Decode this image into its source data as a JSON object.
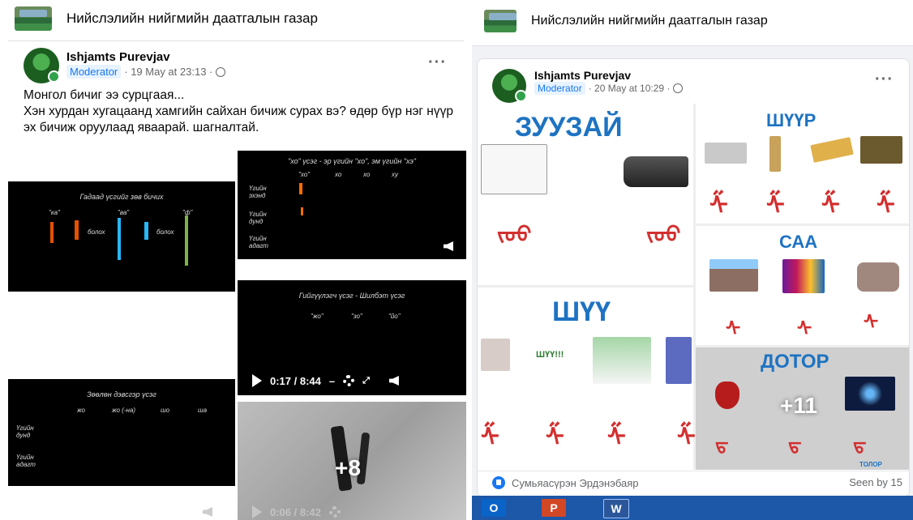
{
  "group": {
    "title": "Нийслэлийн нийгмийн даатгалын газар"
  },
  "left_post": {
    "author": "Ishjamts Purevjav",
    "role": "Moderator",
    "time": "· 19 May at 23:13 ·",
    "text": "Монгол бичиг ээ  сурцгаая...\nХэн хурдан хугацаанд хамгийн сайхан бичиж сурах вэ?  өдөр бүр нэг нүүр  эх бичиж оруулаад яваарай.  шагналтай.",
    "videos": [
      {
        "title": "Гадаад үсгийг зөв бичих",
        "labels": [
          "\"ка\"",
          "\"ва\"",
          "\"ф\"",
          "болох",
          "болох"
        ]
      },
      {
        "title": "\"хо\" үсэг - эр үгийн \"хо\", эм үгийн \"хэ\"",
        "headers": [
          "\"хо\"",
          "хо",
          "хо",
          "ху"
        ],
        "rows": [
          "Үгийн эхэнд",
          "Үгийн дунд",
          "Үгийн адагт"
        ]
      },
      {
        "title": "Гийгүүлэгч үсэг - Шилбэт үсэг",
        "headers": [
          "\"жо\"",
          "\"зо\"",
          "\"йо\""
        ],
        "time": "0:17 / 8:44"
      },
      {
        "title": "Зөөлөн дэвсгэр үсэг",
        "headers": [
          "жо",
          "жо (-на)",
          "шо",
          "ша"
        ],
        "rows": [
          "Үгийн дунд",
          "Үгийн адагт"
        ]
      },
      {
        "count": "+8",
        "time": "0:06 / 8:42"
      }
    ]
  },
  "right_post": {
    "author": "Ishjamts Purevjav",
    "role": "Moderator",
    "time": "· 20 May at 10:29 ·",
    "words": [
      "ЗУУЗАЙ",
      "ШҮҮР",
      "САА",
      "ШҮҮ",
      "ДОТОР"
    ],
    "small_label": "ШҮҮ!!!",
    "bottom_label": "ТОЛОР",
    "count": "+11",
    "reactor": "Сумьяасүрэн Эрдэнэбаяр",
    "seen": "Seen by 15"
  },
  "taskbar": {
    "apps": [
      "O",
      "P",
      "W"
    ]
  },
  "colors": {
    "accent": "#1877f2",
    "mongol_script": "#d32f2f",
    "word_blue": "#1e73c2",
    "taskbar": "#1d57a8"
  }
}
